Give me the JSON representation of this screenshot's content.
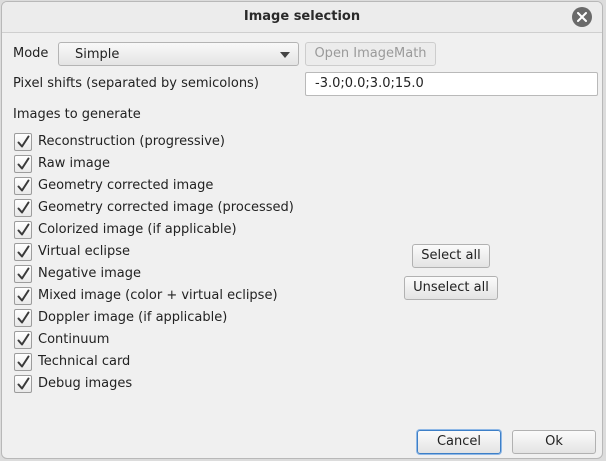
{
  "window": {
    "title": "Image selection",
    "close_icon": "close-icon"
  },
  "mode": {
    "label": "Mode",
    "selected": "Simple",
    "open_imagemath": "Open ImageMath"
  },
  "pixel_shifts": {
    "label": "Pixel shifts (separated by semicolons)",
    "value": "-3.0;0.0;3.0;15.0"
  },
  "images_header": "Images to generate",
  "images": [
    {
      "label": "Reconstruction (progressive)",
      "checked": true
    },
    {
      "label": "Raw image",
      "checked": true
    },
    {
      "label": "Geometry corrected image",
      "checked": true
    },
    {
      "label": "Geometry corrected image (processed)",
      "checked": true
    },
    {
      "label": "Colorized image (if applicable)",
      "checked": true
    },
    {
      "label": "Virtual eclipse",
      "checked": true
    },
    {
      "label": "Negative image",
      "checked": true
    },
    {
      "label": "Mixed image (color + virtual eclipse)",
      "checked": true
    },
    {
      "label": "Doppler image (if applicable)",
      "checked": true
    },
    {
      "label": "Continuum",
      "checked": true
    },
    {
      "label": "Technical card",
      "checked": true
    },
    {
      "label": "Debug images",
      "checked": true
    }
  ],
  "actions": {
    "select_all": "Select all",
    "unselect_all": "Unselect all",
    "cancel": "Cancel",
    "ok": "Ok"
  }
}
